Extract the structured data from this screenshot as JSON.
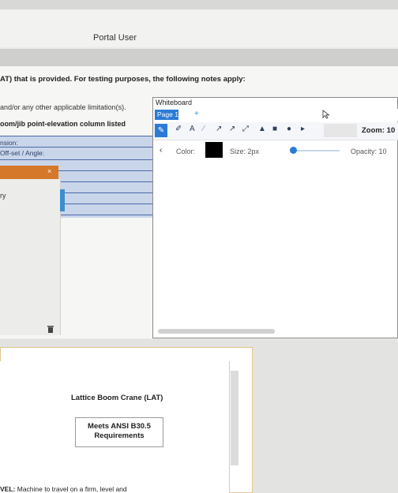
{
  "header": {
    "portal_user": "Portal User"
  },
  "document": {
    "line1": "AT) that is provided.  For testing purposes, the following notes apply:",
    "line2": "and/or any other applicable limitation(s).",
    "line3": "oom/jib point-elevation column listed",
    "table_rows": [
      "nsion:",
      "Off-set / Angle:"
    ]
  },
  "side_panel": {
    "close_glyph": "×",
    "item": "ry"
  },
  "whiteboard": {
    "title": "Whiteboard",
    "tab": "Page 1",
    "add_tab": "+",
    "zoom_label": "Zoom: 10",
    "color_label": "Color:",
    "color_value": "#000000",
    "size_label": "Size: 2px",
    "size_value_fraction": 0.05,
    "opacity_label": "Opacity: 10",
    "back_glyph": "‹",
    "tools": [
      "pen-tool",
      "eraser-tool",
      "text-tool",
      "line-tool",
      "arrow-tool",
      "double-arrow-tool",
      "triangle-tool",
      "square-tool",
      "circle-tool",
      "pointer-tool"
    ]
  },
  "card": {
    "title": "Lattice Boom Crane (LAT)",
    "ansi_line1": "Meets ANSI B30.5",
    "ansi_line2": "Requirements",
    "level_bold": "VEL:",
    "level_text": " Machine to travel on a firm, level and"
  },
  "colors": {
    "accent": "#2b7bd6",
    "orange": "#d6782a",
    "table_blue": "#c9d6ea"
  }
}
